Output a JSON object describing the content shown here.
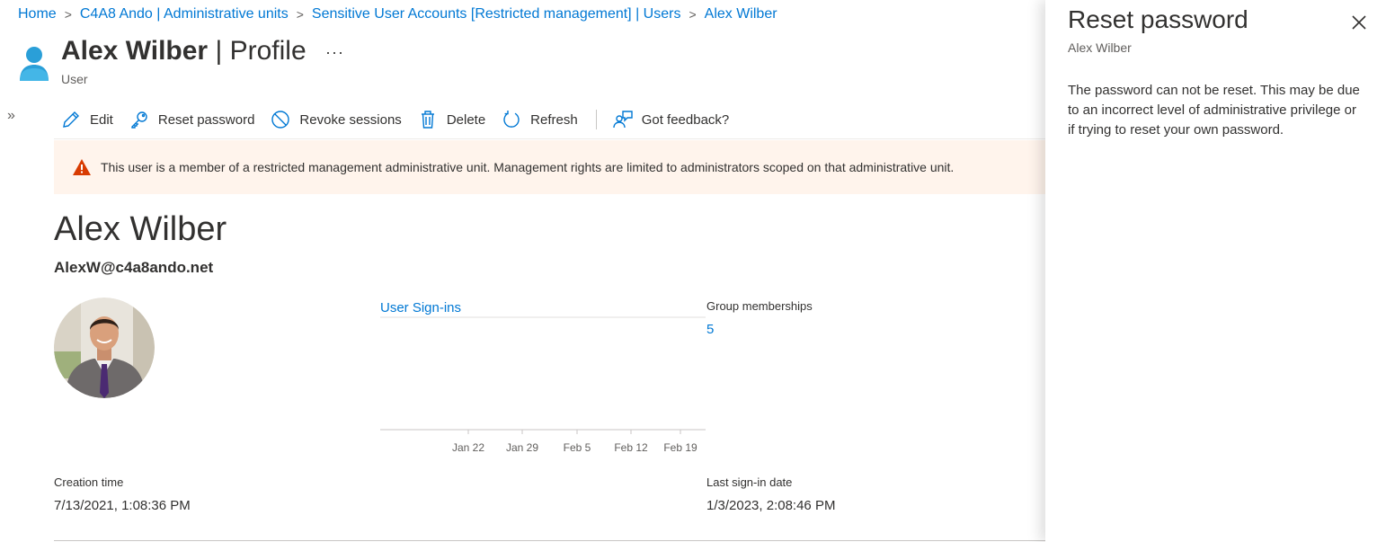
{
  "breadcrumb": [
    {
      "label": "Home"
    },
    {
      "label": "C4A8 Ando | Administrative units"
    },
    {
      "label": "Sensitive User Accounts [Restricted management] | Users"
    },
    {
      "label": "Alex Wilber"
    }
  ],
  "header": {
    "name": "Alex Wilber",
    "pipe": " | ",
    "section": "Profile",
    "more": "···",
    "subtitle": "User",
    "expand": "»"
  },
  "toolbar": {
    "edit": "Edit",
    "reset_password": "Reset password",
    "revoke_sessions": "Revoke sessions",
    "delete": "Delete",
    "refresh": "Refresh",
    "feedback": "Got feedback?"
  },
  "banner": {
    "text": "This user is a member of a restricted management administrative unit. Management rights are limited to administrators scoped on that administrative unit."
  },
  "profile": {
    "display_name": "Alex Wilber",
    "upn": "AlexW@c4a8ando.net"
  },
  "signins": {
    "title": "User Sign-ins",
    "ticks": [
      "Jan 22",
      "Jan 29",
      "Feb 5",
      "Feb 12",
      "Feb 19"
    ]
  },
  "groups": {
    "label": "Group memberships",
    "value": "5"
  },
  "creation": {
    "label": "Creation time",
    "value": "7/13/2021, 1:08:36 PM"
  },
  "last_signin": {
    "label": "Last sign-in date",
    "value": "1/3/2023, 2:08:46 PM"
  },
  "panel": {
    "title": "Reset password",
    "subtitle": "Alex Wilber",
    "message": "The password can not be reset. This may be due to an incorrect level of administrative privilege or if trying to reset your own password."
  },
  "colors": {
    "accent": "#0078d4",
    "warning": "#d83b01",
    "banner_bg": "#fff4ec"
  },
  "icons": [
    "user-icon",
    "pencil-icon",
    "key-icon",
    "block-icon",
    "trash-icon",
    "refresh-icon",
    "feedback-icon",
    "warning-icon",
    "close-icon"
  ]
}
